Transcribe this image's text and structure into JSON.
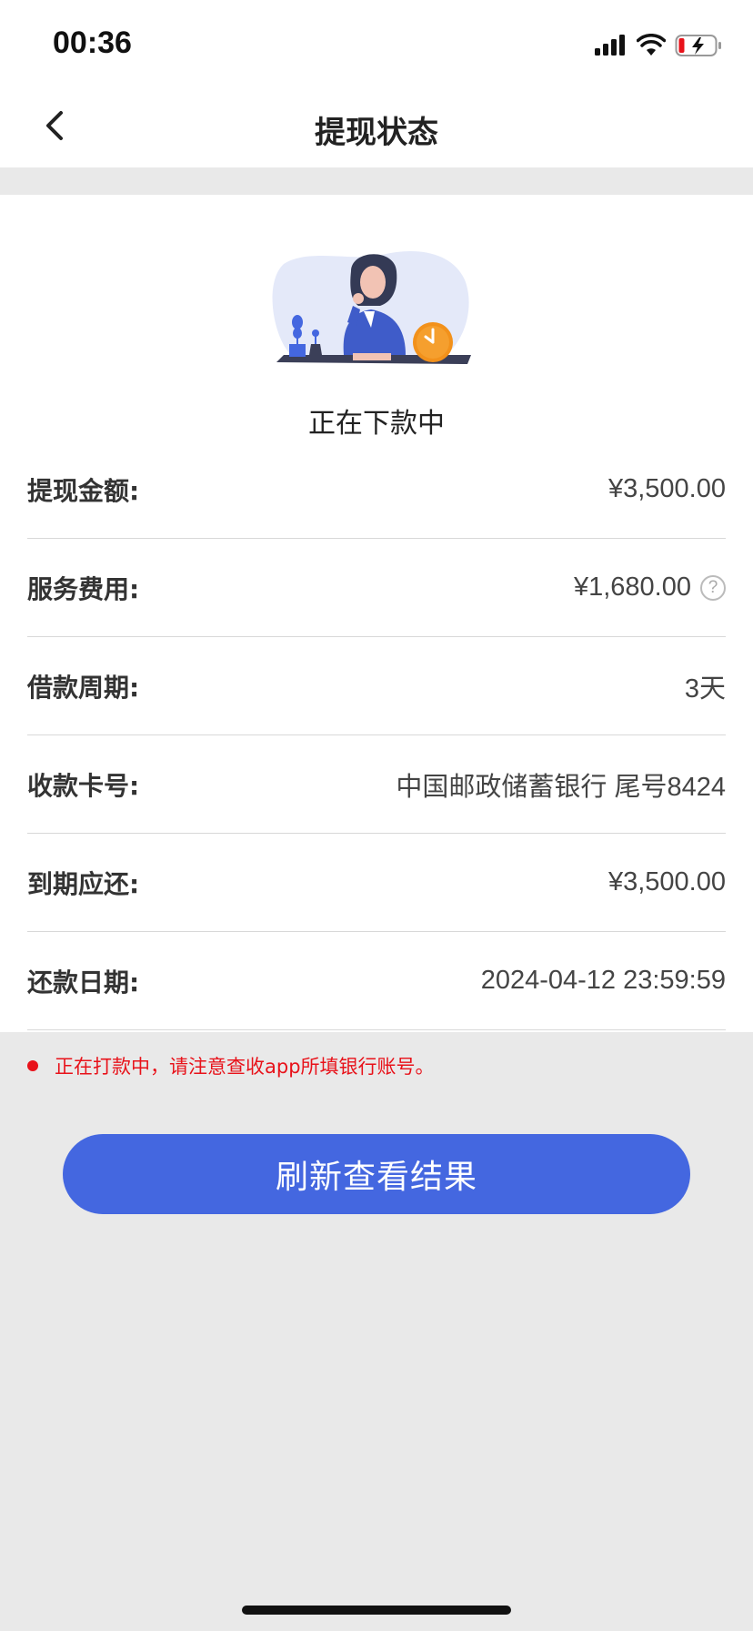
{
  "status_bar": {
    "time": "00:36",
    "icons": [
      "signal-icon",
      "wifi-icon",
      "battery-charging-icon"
    ],
    "battery_color": "#e8121a"
  },
  "nav": {
    "title": "提现状态",
    "back_icon": "chevron-left-icon"
  },
  "status": {
    "text": "正在下款中",
    "illustration": "woman-waiting-clock-illustration"
  },
  "details": [
    {
      "label": "提现金额:",
      "value": "¥3,500.00"
    },
    {
      "label": "服务费用:",
      "value": "¥1,680.00",
      "help_icon": "?"
    },
    {
      "label": "借款周期:",
      "value": "3天"
    },
    {
      "label": "收款卡号:",
      "value": "中国邮政储蓄银行 尾号8424"
    },
    {
      "label": "到期应还:",
      "value": "¥3,500.00"
    },
    {
      "label": "还款日期:",
      "value": "2024-04-12 23:59:59"
    }
  ],
  "notice": {
    "text": "正在打款中，请注意查收app所填银行账号。",
    "color": "#e8121a"
  },
  "actions": {
    "refresh_label": "刷新查看结果",
    "button_color": "#4467e0"
  }
}
